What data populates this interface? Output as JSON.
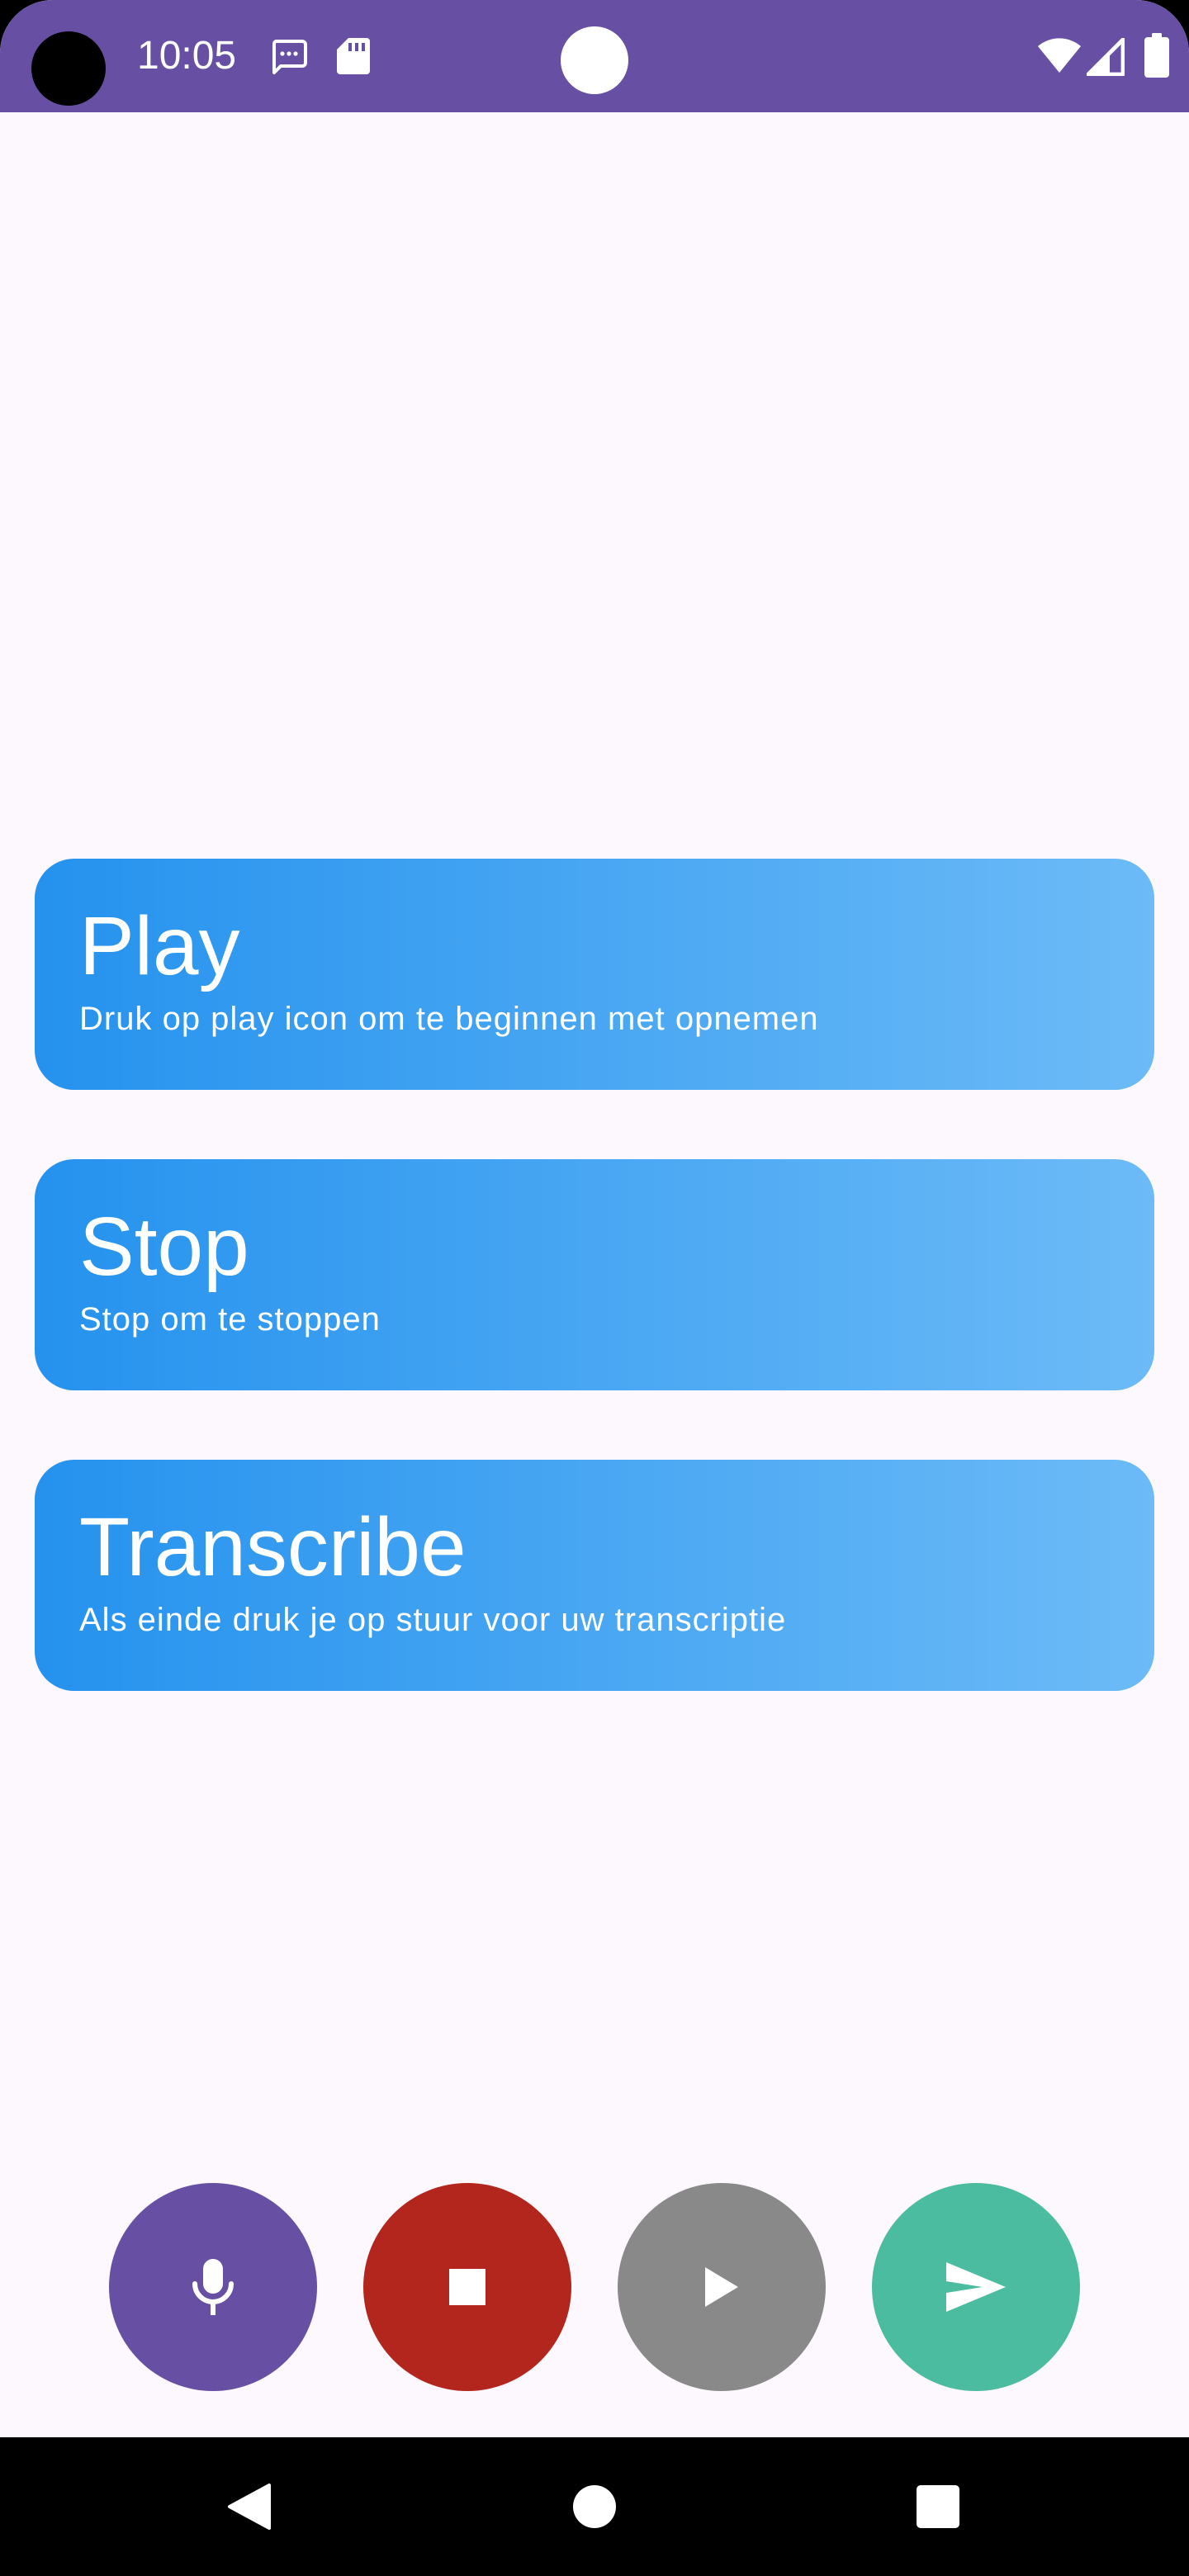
{
  "colors": {
    "status_bar": "#6750a4",
    "background": "#fdf8fd",
    "card_gradient_start": "#2592ee",
    "card_gradient_end": "#6cbbf7",
    "fab_mic": "#6750a4",
    "fab_stop": "#b3261e",
    "fab_play": "#898989",
    "fab_send": "#4cbca1"
  },
  "status_bar": {
    "time": "10:05",
    "icons": [
      "camera-cutout",
      "message-icon",
      "sd-card-icon",
      "wifi-icon",
      "signal-icon",
      "battery-icon"
    ]
  },
  "cards": [
    {
      "title": "Play",
      "subtitle": "Druk op play icon om te beginnen met opnemen"
    },
    {
      "title": "Stop",
      "subtitle": "Stop om te stoppen"
    },
    {
      "title": "Transcribe",
      "subtitle": "Als einde druk je op stuur voor uw transcriptie"
    }
  ],
  "fabs": [
    {
      "icon": "mic-icon",
      "color": "#6750a4"
    },
    {
      "icon": "stop-icon",
      "color": "#b3261e"
    },
    {
      "icon": "play-icon",
      "color": "#898989"
    },
    {
      "icon": "send-icon",
      "color": "#4cbca1"
    }
  ],
  "nav_bar": {
    "icons": [
      "back-icon",
      "home-icon",
      "recents-icon"
    ]
  }
}
